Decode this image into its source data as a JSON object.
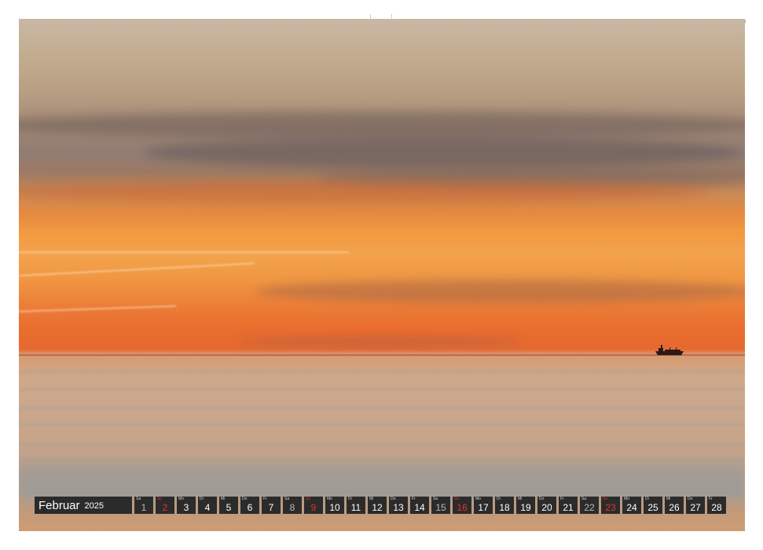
{
  "calendar": {
    "month": "Februar",
    "year": "2025",
    "days": [
      {
        "wd": "Sa",
        "num": "1",
        "kind": "sat"
      },
      {
        "wd": "So",
        "num": "2",
        "kind": "sun"
      },
      {
        "wd": "Mo",
        "num": "3",
        "kind": "day"
      },
      {
        "wd": "Di",
        "num": "4",
        "kind": "day"
      },
      {
        "wd": "Mi",
        "num": "5",
        "kind": "day"
      },
      {
        "wd": "Do",
        "num": "6",
        "kind": "day"
      },
      {
        "wd": "Fr",
        "num": "7",
        "kind": "day"
      },
      {
        "wd": "Sa",
        "num": "8",
        "kind": "sat"
      },
      {
        "wd": "So",
        "num": "9",
        "kind": "sun"
      },
      {
        "wd": "Mo",
        "num": "10",
        "kind": "day"
      },
      {
        "wd": "Di",
        "num": "11",
        "kind": "day"
      },
      {
        "wd": "Mi",
        "num": "12",
        "kind": "day"
      },
      {
        "wd": "Do",
        "num": "13",
        "kind": "day"
      },
      {
        "wd": "Fr",
        "num": "14",
        "kind": "day"
      },
      {
        "wd": "Sa",
        "num": "15",
        "kind": "sat"
      },
      {
        "wd": "So",
        "num": "16",
        "kind": "sun"
      },
      {
        "wd": "Mo",
        "num": "17",
        "kind": "day"
      },
      {
        "wd": "Di",
        "num": "18",
        "kind": "day"
      },
      {
        "wd": "Mi",
        "num": "19",
        "kind": "day"
      },
      {
        "wd": "Do",
        "num": "20",
        "kind": "day"
      },
      {
        "wd": "Fr",
        "num": "21",
        "kind": "day"
      },
      {
        "wd": "Sa",
        "num": "22",
        "kind": "sat"
      },
      {
        "wd": "So",
        "num": "23",
        "kind": "sun"
      },
      {
        "wd": "Mo",
        "num": "24",
        "kind": "day"
      },
      {
        "wd": "Di",
        "num": "25",
        "kind": "day"
      },
      {
        "wd": "Mi",
        "num": "26",
        "kind": "day"
      },
      {
        "wd": "Do",
        "num": "27",
        "kind": "day"
      },
      {
        "wd": "Fr",
        "num": "28",
        "kind": "day"
      }
    ]
  },
  "colors": {
    "sunday": "#e0352b",
    "saturday": "#b9b9b9",
    "bar": "#2b2b2b"
  },
  "photo": {
    "icon": "ship-silhouette-icon"
  }
}
